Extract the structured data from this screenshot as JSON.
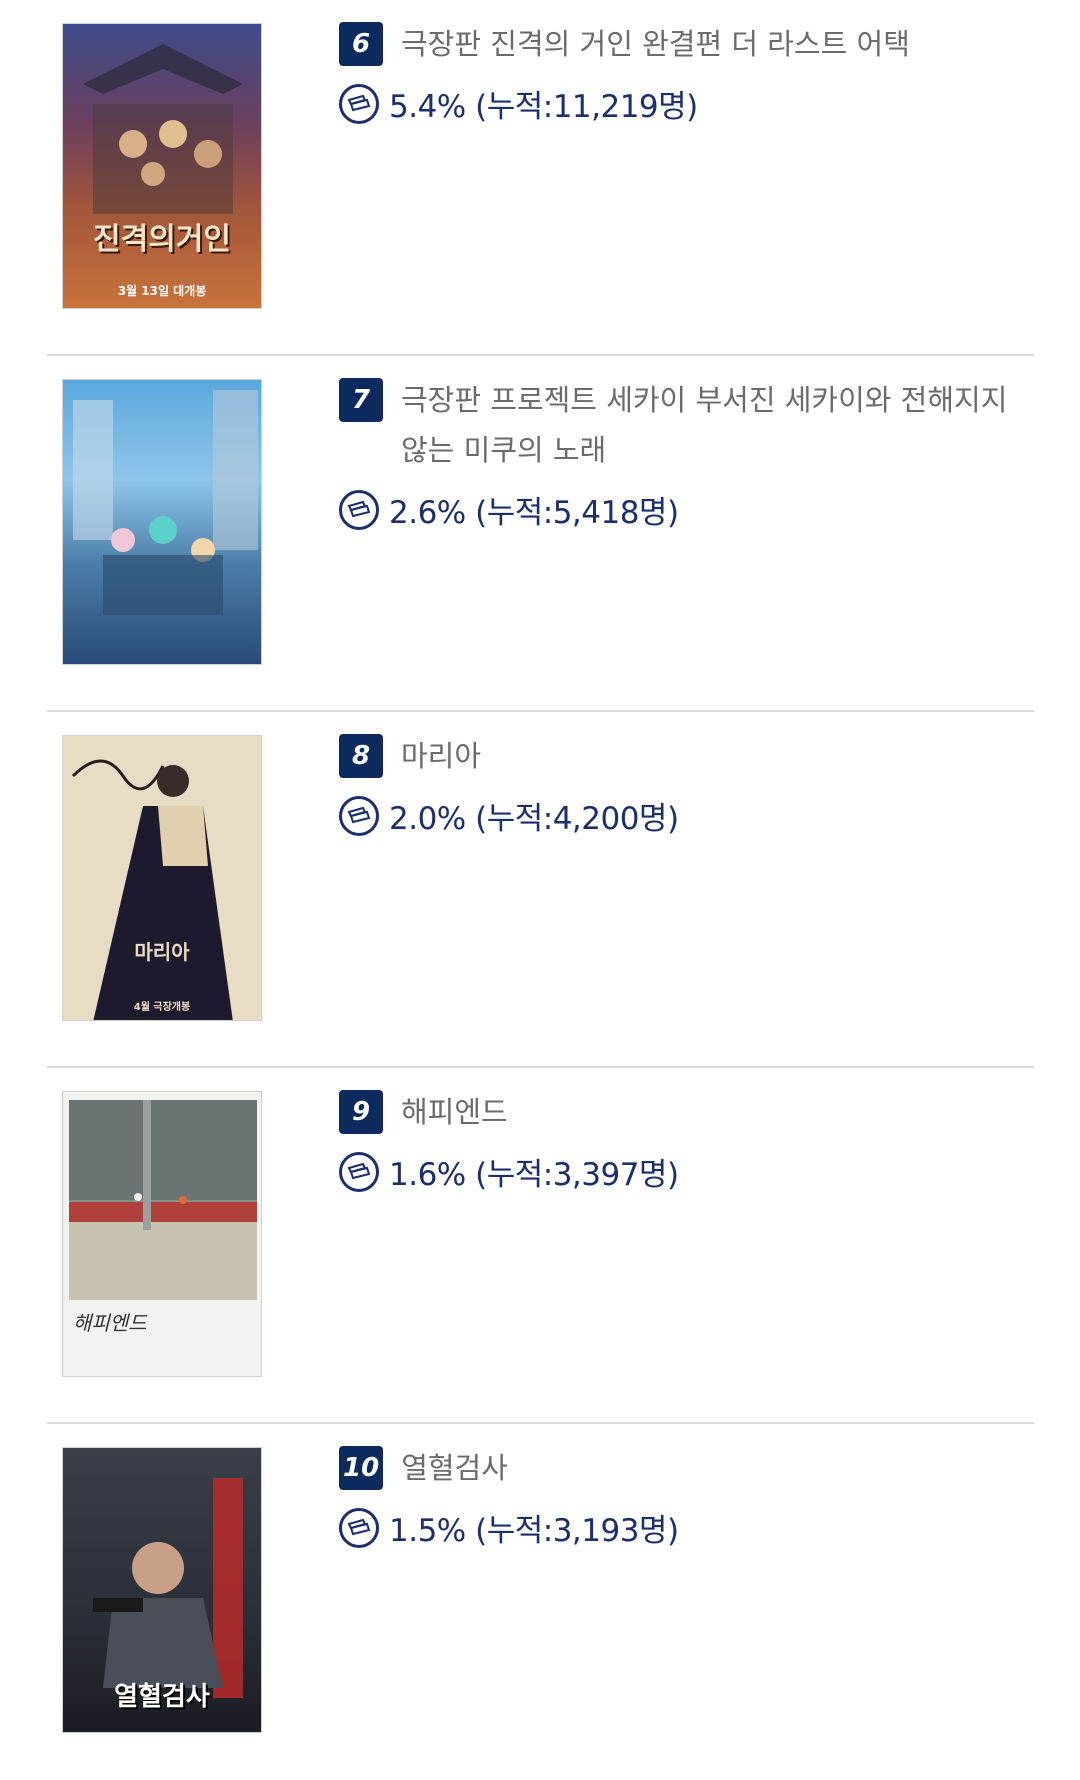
{
  "colors": {
    "rank_bg": "#0d2a5e",
    "stat_text": "#1c2f6c",
    "title_text": "#6b6b6b",
    "divider": "#d9d9d9"
  },
  "items": [
    {
      "rank": "6",
      "title": "극장판 진격의 거인 완결편 더 라스트 어택",
      "stat": "5.4% (누적:11,219명)",
      "icon": "ticket-icon",
      "poster": {
        "text": "진격의거인",
        "sub": "3월 13일 대개봉",
        "bg": "#8a4a2a"
      }
    },
    {
      "rank": "7",
      "title": "극장판 프로젝트 세카이 부서진 세카이와 전해지지 않는 미쿠의 노래",
      "stat": "2.6% (누적:5,418명)",
      "icon": "ticket-icon",
      "poster": {
        "text": "",
        "sub": "",
        "bg": "#3a8fc4"
      }
    },
    {
      "rank": "8",
      "title": "마리아",
      "stat": "2.0% (누적:4,200명)",
      "icon": "ticket-icon",
      "poster": {
        "text": "마리아",
        "sub": "4월 극장개봉",
        "bg": "#e8dcc4"
      }
    },
    {
      "rank": "9",
      "title": "해피엔드",
      "stat": "1.6% (누적:3,397명)",
      "icon": "ticket-icon",
      "poster": {
        "text": "해피엔드",
        "sub": "",
        "bg": "#f0f0ee"
      }
    },
    {
      "rank": "10",
      "title": "열혈검사",
      "stat": "1.5% (누적:3,193명)",
      "icon": "ticket-icon",
      "poster": {
        "text": "열혈검사",
        "sub": "",
        "bg": "#2a2e36"
      }
    }
  ]
}
